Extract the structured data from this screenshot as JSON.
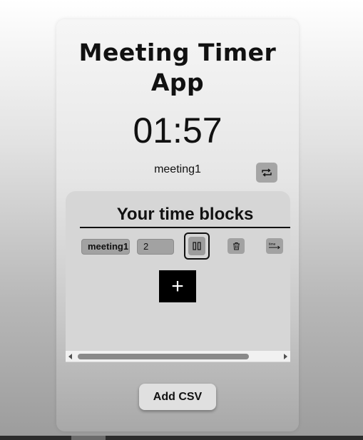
{
  "app": {
    "title": "Meeting Timer App",
    "timer_display": "01:57",
    "current_meeting": "meeting1",
    "loop_icon": "repeat-icon"
  },
  "time_blocks": {
    "heading": "Your time blocks",
    "blocks": [
      {
        "name": "meeting1",
        "duration": "2",
        "pause_icon": "pause-icon",
        "delete_icon": "trash-icon",
        "move_icon": "time-arrow-icon",
        "move_icon_text": "time"
      }
    ],
    "add_symbol": "+"
  },
  "csv_button": {
    "label": "Add CSV"
  },
  "colors": {
    "add_block_bg": "#000000",
    "panel_bg": "#d6d6d6",
    "button_gray": "#a2a2a2"
  }
}
